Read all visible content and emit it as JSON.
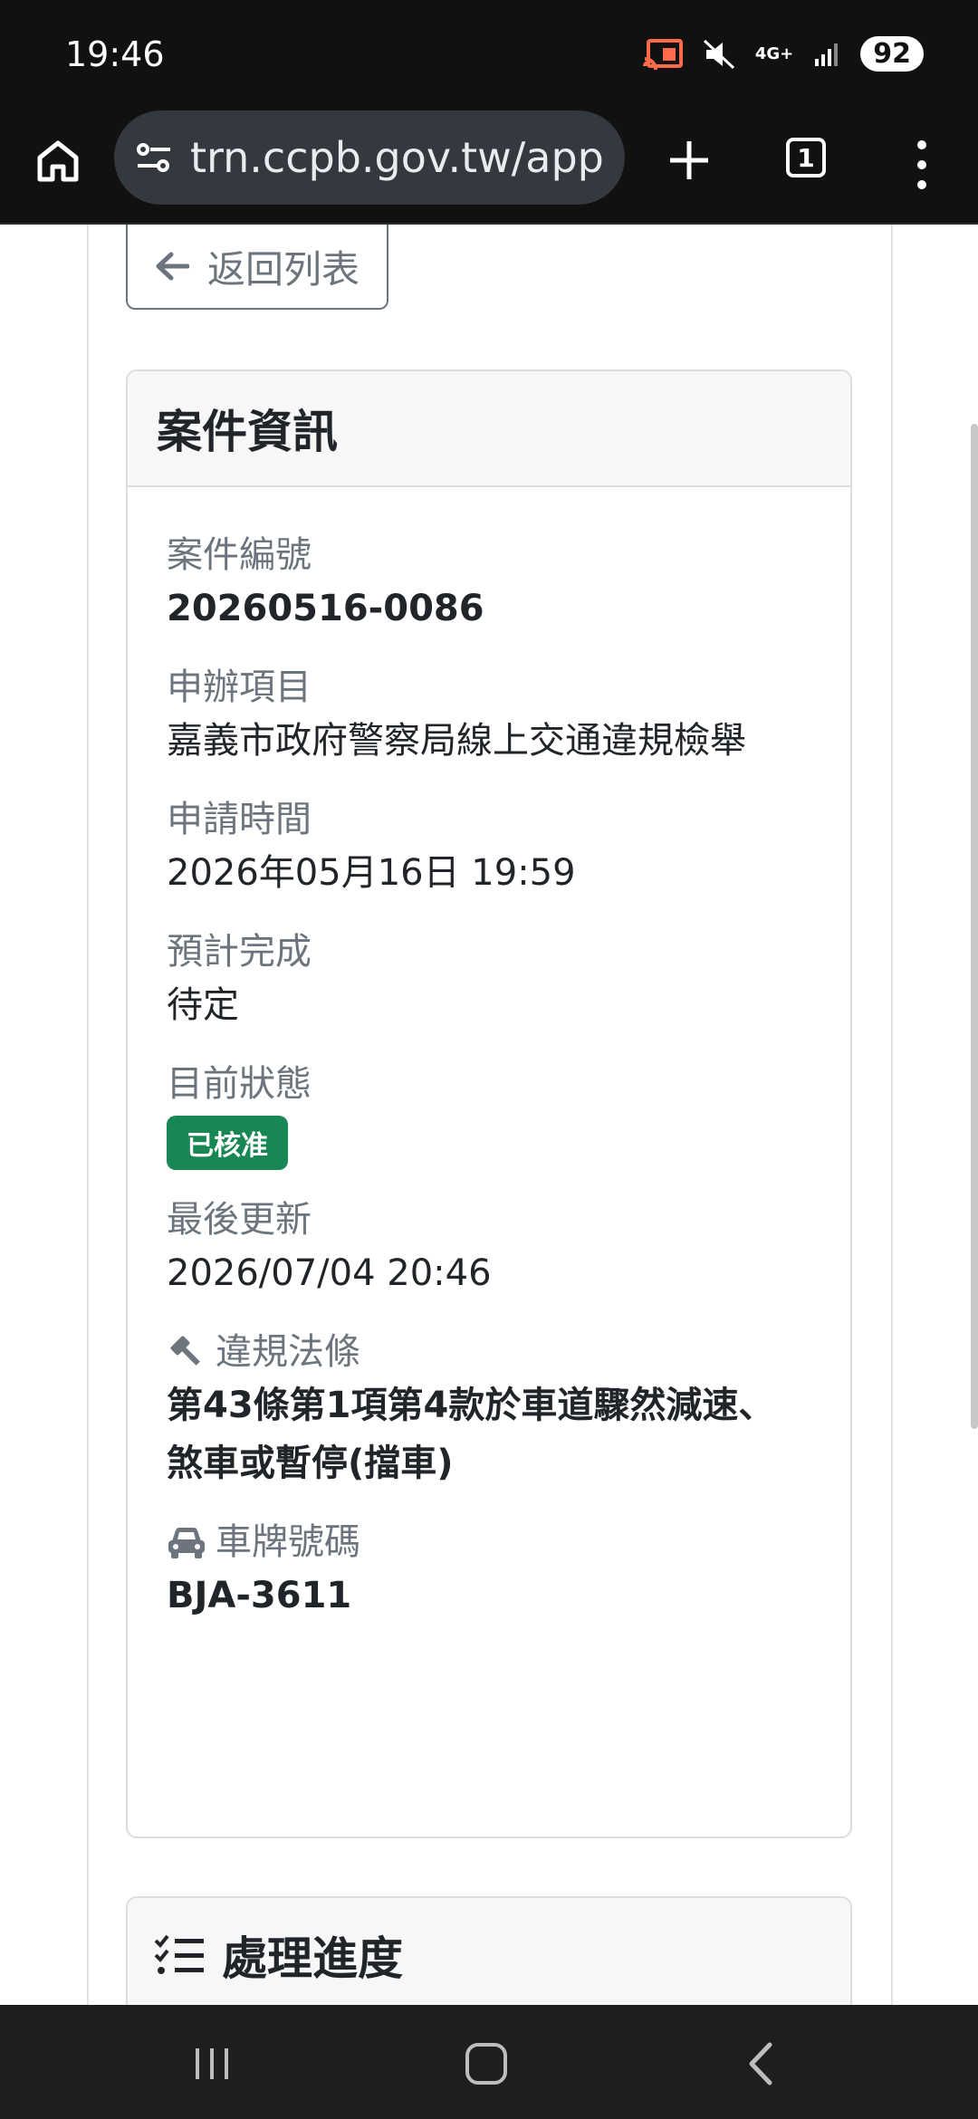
{
  "status_bar": {
    "time": "19:46",
    "network": "4G+",
    "battery": "92",
    "icons": [
      "cast-icon",
      "mute-icon",
      "network-icon",
      "signal-icon",
      "battery-icon"
    ]
  },
  "browser": {
    "url": "trn.ccpb.gov.tw/applic",
    "tab_count": "1",
    "icons": [
      "home-icon",
      "site-settings-icon",
      "new-tab-icon",
      "tab-switcher-icon",
      "menu-icon"
    ]
  },
  "page": {
    "back_button": "返回列表",
    "case_card": {
      "title": "案件資訊",
      "fields": {
        "case_number": {
          "label": "案件編號",
          "value": "20260516-0086"
        },
        "application_item": {
          "label": "申辦項目",
          "value": "嘉義市政府警察局線上交通違規檢舉"
        },
        "application_time": {
          "label": "申請時間",
          "value": "2026年05月16日 19:59"
        },
        "expected_completion": {
          "label": "預計完成",
          "value": "待定"
        },
        "current_status": {
          "label": "目前狀態",
          "value": "已核准"
        },
        "last_updated": {
          "label": "最後更新",
          "value": "2026/07/04 20:46"
        },
        "violation_law": {
          "label": "違規法條",
          "value_line1": "第43條第1項第4款於車道驟然減速、",
          "value_line2": "煞車或暫停(擋車)"
        },
        "license_plate": {
          "label": "車牌號碼",
          "value": "BJA-3611"
        }
      }
    },
    "progress_card": {
      "title": "處理進度"
    }
  },
  "colors": {
    "status_badge": "#198754",
    "label_gray": "#6c757d",
    "system_bar": "#111111"
  }
}
